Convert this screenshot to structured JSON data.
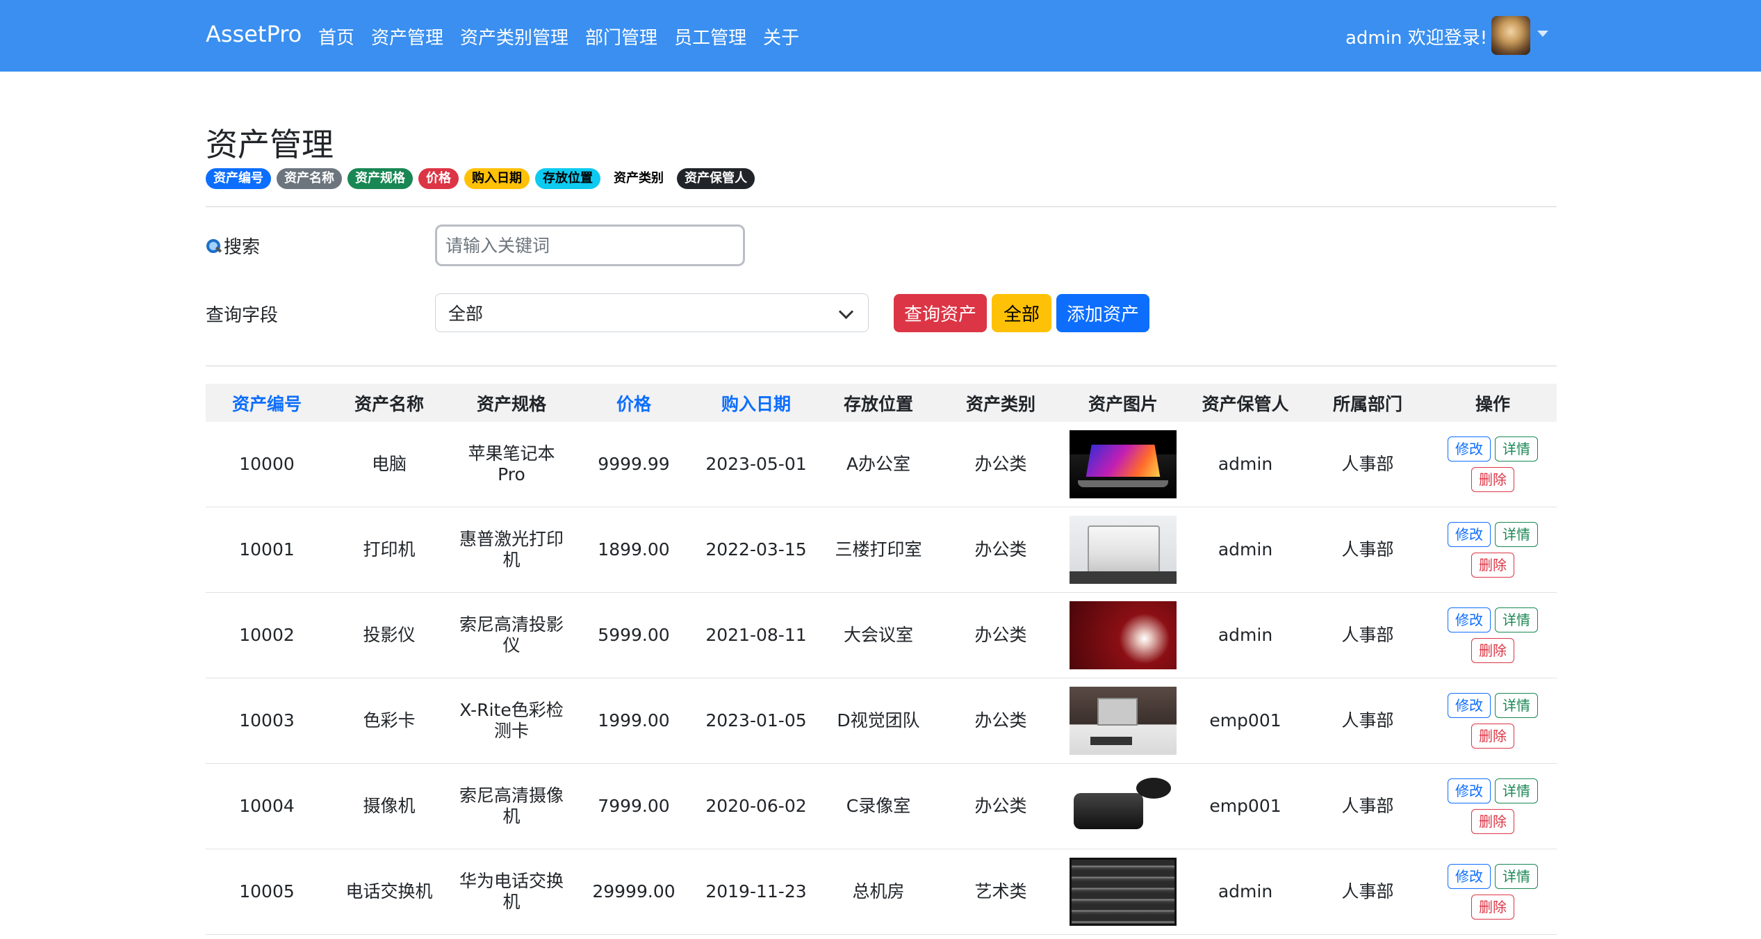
{
  "navbar": {
    "brand": "AssetPro",
    "links": [
      "首页",
      "资产管理",
      "资产类别管理",
      "部门管理",
      "员工管理",
      "关于"
    ],
    "welcome": "admin 欢迎登录!"
  },
  "page": {
    "title": "资产管理",
    "badges": [
      "资产编号",
      "资产名称",
      "资产规格",
      "价格",
      "购入日期",
      "存放位置",
      "资产类别",
      "资产保管人"
    ]
  },
  "search": {
    "label": "搜索",
    "placeholder": "请输入关键词"
  },
  "query": {
    "label": "查询字段",
    "selected": "全部",
    "buttons": {
      "query": "查询资产",
      "all": "全部",
      "add": "添加资产"
    }
  },
  "table": {
    "headers": [
      "资产编号",
      "资产名称",
      "资产规格",
      "价格",
      "购入日期",
      "存放位置",
      "资产类别",
      "资产图片",
      "资产保管人",
      "所属部门",
      "操作"
    ],
    "actions": {
      "edit": "修改",
      "detail": "详情",
      "delete": "删除"
    },
    "rows": [
      {
        "id": "10000",
        "name": "电脑",
        "spec": "苹果笔记本Pro",
        "price": "9999.99",
        "date": "2023-05-01",
        "location": "A办公室",
        "category": "办公类",
        "image": "laptop",
        "keeper": "admin",
        "dept": "人事部"
      },
      {
        "id": "10001",
        "name": "打印机",
        "spec": "惠普激光打印机",
        "price": "1899.00",
        "date": "2022-03-15",
        "location": "三楼打印室",
        "category": "办公类",
        "image": "printer",
        "keeper": "admin",
        "dept": "人事部"
      },
      {
        "id": "10002",
        "name": "投影仪",
        "spec": "索尼高清投影仪",
        "price": "5999.00",
        "date": "2021-08-11",
        "location": "大会议室",
        "category": "办公类",
        "image": "projector",
        "keeper": "admin",
        "dept": "人事部"
      },
      {
        "id": "10003",
        "name": "色彩卡",
        "spec": "X-Rite色彩检测卡",
        "price": "1999.00",
        "date": "2023-01-05",
        "location": "D视觉团队",
        "category": "办公类",
        "image": "card",
        "keeper": "emp001",
        "dept": "人事部"
      },
      {
        "id": "10004",
        "name": "摄像机",
        "spec": "索尼高清摄像机",
        "price": "7999.00",
        "date": "2020-06-02",
        "location": "C录像室",
        "category": "办公类",
        "image": "camera",
        "keeper": "emp001",
        "dept": "人事部"
      },
      {
        "id": "10005",
        "name": "电话交换机",
        "spec": "华为电话交换机",
        "price": "29999.00",
        "date": "2019-11-23",
        "location": "总机房",
        "category": "艺术类",
        "image": "switch",
        "keeper": "admin",
        "dept": "人事部"
      }
    ]
  }
}
